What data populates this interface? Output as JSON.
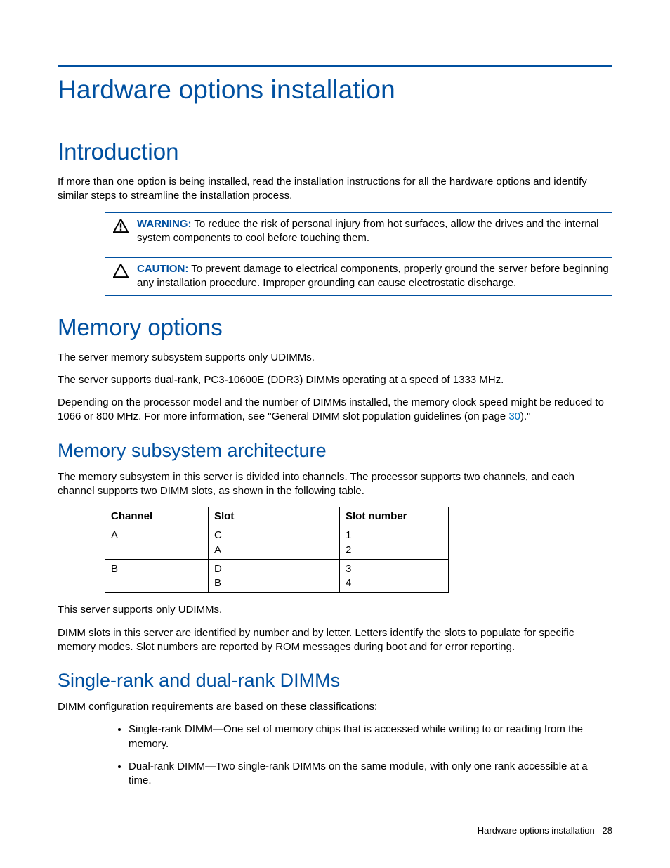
{
  "h1": "Hardware options installation",
  "intro": {
    "heading": "Introduction",
    "para": "If more than one option is being installed, read the installation instructions for all the hardware options and identify similar steps to streamline the installation process.",
    "warning": {
      "label": "WARNING:",
      "text": "  To reduce the risk of personal injury from hot surfaces, allow the drives and the internal system components to cool before touching them."
    },
    "caution": {
      "label": "CAUTION:",
      "text": "  To prevent damage to electrical components, properly ground the server before beginning any installation procedure. Improper grounding can cause electrostatic discharge."
    }
  },
  "memory": {
    "heading": "Memory options",
    "p1": "The server memory subsystem supports only UDIMMs.",
    "p2": "The server supports dual-rank, PC3-10600E (DDR3) DIMMs operating at a speed of 1333 MHz.",
    "p3_a": "Depending on the processor model and the number of DIMMs installed, the memory clock speed might be reduced to 1066 or 800 MHz. For more information, see \"General DIMM slot population guidelines (on page ",
    "p3_link": "30",
    "p3_b": ").\""
  },
  "arch": {
    "heading": "Memory subsystem architecture",
    "intro": "The memory subsystem in this server is divided into channels. The processor supports two channels, and each channel supports two DIMM slots, as shown in the following table.",
    "table": {
      "headers": [
        "Channel",
        "Slot",
        "Slot number"
      ],
      "rows": [
        {
          "channel": "A",
          "slot": "C\nA",
          "num": "1\n2"
        },
        {
          "channel": "B",
          "slot": "D\nB",
          "num": "3\n4"
        }
      ]
    },
    "after1": "This server supports only UDIMMs.",
    "after2": "DIMM slots in this server are identified by number and by letter. Letters identify the slots to populate for specific memory modes. Slot numbers are reported by ROM messages during boot and for error reporting."
  },
  "ranks": {
    "heading": "Single-rank and dual-rank DIMMs",
    "intro": "DIMM configuration requirements are based on these classifications:",
    "items": [
      "Single-rank DIMM—One set of memory chips that is accessed while writing to or reading from the memory.",
      "Dual-rank DIMM—Two single-rank DIMMs on the same module, with only one rank accessible at a time."
    ]
  },
  "footer": {
    "section": "Hardware options installation",
    "page": "28"
  }
}
